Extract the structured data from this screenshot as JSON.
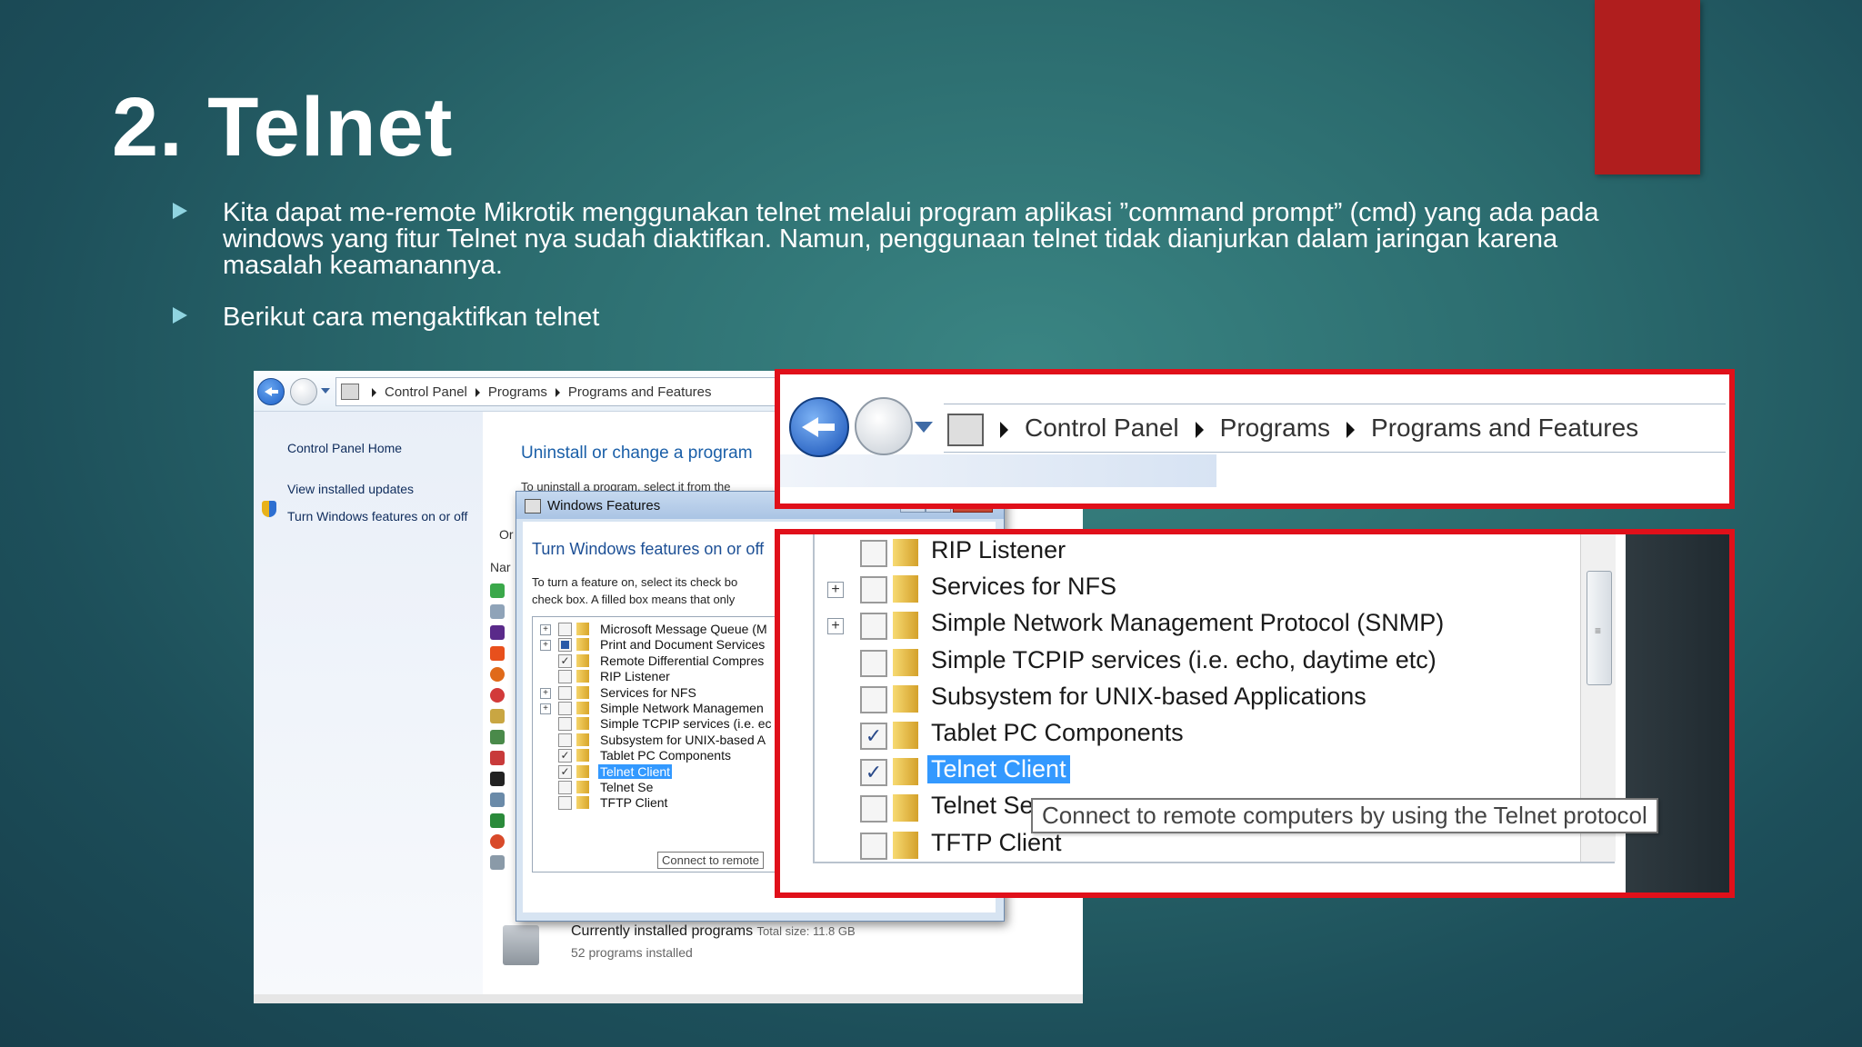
{
  "slide": {
    "title": "2. Telnet",
    "bullets": [
      "Kita dapat me-remote Mikrotik menggunakan telnet melalui program aplikasi ”command prompt” (cmd)  yang ada pada windows yang fitur Telnet nya sudah diaktifkan. Namun, penggunaan telnet tidak dianjurkan dalam jaringan karena masalah keamanannya.",
      "Berikut cara mengaktifkan telnet"
    ],
    "accent_color": "#b01e1e"
  },
  "address_bar": {
    "crumbs": [
      "Control Panel",
      "Programs",
      "Programs and Features"
    ]
  },
  "control_panel": {
    "sidebar": {
      "home": "Control Panel Home",
      "updates": "View installed updates",
      "features": "Turn Windows features on or off"
    },
    "heading": "Uninstall or change a program",
    "description": "To uninstall a program, select it from the",
    "organize": "Or",
    "name_col": "Nar",
    "footer": {
      "title": "Currently installed programs",
      "total": "Total size: 11.8 GB",
      "count": "52 programs installed"
    }
  },
  "windows_features": {
    "title": "Windows Features",
    "heading": "Turn Windows features on or off",
    "desc_line1": "To turn a feature on, select its check bo",
    "desc_line2": "check box. A filled box means that only",
    "items": [
      {
        "label": "Microsoft Message Queue (M",
        "state": "unchecked",
        "expandable": true
      },
      {
        "label": "Print and Document Services",
        "state": "partial",
        "expandable": true
      },
      {
        "label": "Remote Differential Compres",
        "state": "checked",
        "expandable": false
      },
      {
        "label": "RIP Listener",
        "state": "unchecked",
        "expandable": false
      },
      {
        "label": "Services for NFS",
        "state": "unchecked",
        "expandable": true
      },
      {
        "label": "Simple Network Managemen",
        "state": "unchecked",
        "expandable": true
      },
      {
        "label": "Simple TCPIP services (i.e. ec",
        "state": "unchecked",
        "expandable": false
      },
      {
        "label": "Subsystem for UNIX-based A",
        "state": "unchecked",
        "expandable": false
      },
      {
        "label": "Tablet PC Components",
        "state": "checked",
        "expandable": false
      },
      {
        "label": "Telnet Client",
        "state": "checked",
        "expandable": false,
        "selected": true
      },
      {
        "label": "Telnet Se",
        "state": "unchecked",
        "expandable": false
      },
      {
        "label": "TFTP Client",
        "state": "unchecked",
        "expandable": false
      }
    ],
    "tooltip": "Connect to remote"
  },
  "zoom_features": {
    "items": [
      {
        "label": "RIP Listener",
        "state": "unchecked",
        "expandable": false
      },
      {
        "label": "Services for NFS",
        "state": "unchecked",
        "expandable": true
      },
      {
        "label": "Simple Network Management Protocol (SNMP)",
        "state": "unchecked",
        "expandable": true
      },
      {
        "label": "Simple TCPIP services (i.e. echo, daytime etc)",
        "state": "unchecked",
        "expandable": false
      },
      {
        "label": "Subsystem for UNIX-based Applications",
        "state": "unchecked",
        "expandable": false
      },
      {
        "label": "Tablet PC Components",
        "state": "checked",
        "expandable": false
      },
      {
        "label": "Telnet Client",
        "state": "checked",
        "expandable": false,
        "selected": true
      },
      {
        "label": "Telnet Se",
        "state": "unchecked",
        "expandable": false
      },
      {
        "label": "TFTP Client",
        "state": "unchecked",
        "expandable": false
      }
    ],
    "tooltip": "Connect to remote computers by using the Telnet protocol"
  },
  "highlight_color": "#e0101a"
}
